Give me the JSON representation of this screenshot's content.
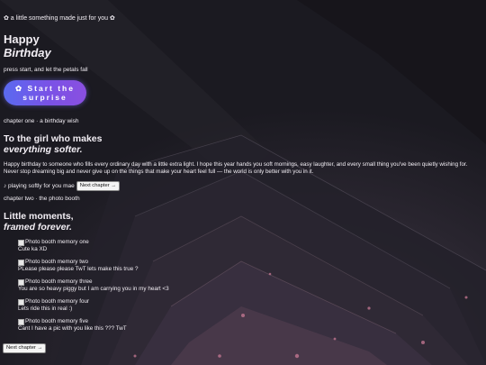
{
  "tagline": "✿ a little something made just for you ✿",
  "hero": {
    "title_line1": "Happy",
    "title_line2": "Birthday",
    "subtitle": "press start, and let the petals fall",
    "start_button": "✿ Start the surprise"
  },
  "chapter_one": {
    "label": "chapter one · a birthday wish",
    "title_line1": "To the girl who makes",
    "title_line2": "everything softer.",
    "message": "Happy birthday to someone who fills every ordinary day with a little extra light. I hope this year hands you soft mornings, easy laughter, and every small thing you've been quietly wishing for. Never stop dreaming big and never give up on the things that make your heart feel full — the world is only better with you in it.",
    "playing": "♪ playing softly for you mae",
    "next_button": "Next chapter →"
  },
  "chapter_two": {
    "label": "chapter two · the photo booth",
    "title_line1": "Little moments,",
    "title_line2": "framed forever.",
    "memories": [
      {
        "alt": "Photo booth memory one",
        "caption": "Cute ka XD"
      },
      {
        "alt": "Photo booth memory two",
        "caption": "PLease please please TwT lets make this true ?"
      },
      {
        "alt": "Photo booth memory three",
        "caption": "You are so heavy piggy but I am carrying you in my heart <3"
      },
      {
        "alt": "Photo booth memory four",
        "caption": "Lets ride this in real :)"
      },
      {
        "alt": "Photo booth memory five",
        "caption": "Cant I have a pic with you like this ??? TwT"
      }
    ],
    "next_button": "Next chapter →"
  }
}
